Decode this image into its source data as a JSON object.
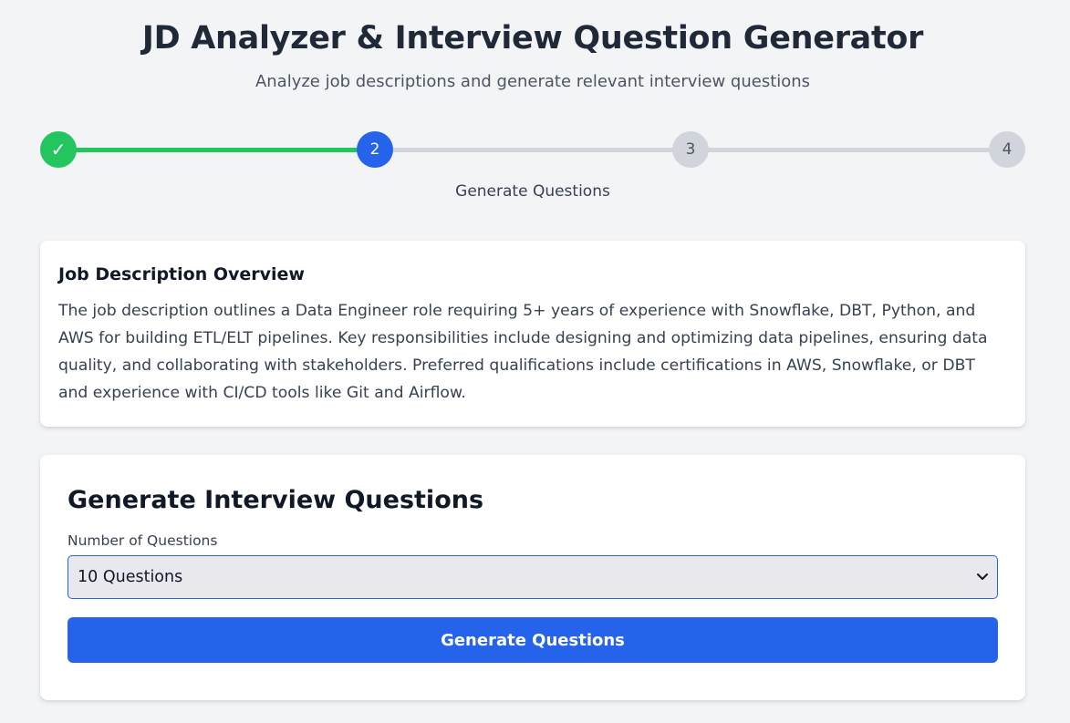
{
  "header": {
    "title": "JD Analyzer & Interview Question Generator",
    "subtitle": "Analyze job descriptions and generate relevant interview questions"
  },
  "stepper": {
    "steps": [
      {
        "label": "✓",
        "state": "complete"
      },
      {
        "label": "2",
        "state": "active"
      },
      {
        "label": "3",
        "state": "inactive"
      },
      {
        "label": "4",
        "state": "inactive"
      }
    ],
    "current_step_label": "Generate Questions",
    "colors": {
      "complete": "#22c55e",
      "active": "#2563eb",
      "inactive": "#d1d5db"
    }
  },
  "overview": {
    "title": "Job Description Overview",
    "body": "The job description outlines a Data Engineer role requiring 5+ years of experience with Snowflake, DBT, Python, and AWS for building ETL/ELT pipelines. Key responsibilities include designing and optimizing data pipelines, ensuring data quality, and collaborating with stakeholders. Preferred qualifications include certifications in AWS, Snowflake, or DBT and experience with CI/CD tools like Git and Airflow."
  },
  "generate": {
    "title": "Generate Interview Questions",
    "count_label": "Number of Questions",
    "count_selected": "10 Questions",
    "button_label": "Generate Questions"
  },
  "icons": {
    "check": "check-icon",
    "chevron": "chevron-down-icon"
  },
  "colors": {
    "accent": "#2563eb",
    "success": "#22c55e",
    "background": "#f3f4f6"
  }
}
